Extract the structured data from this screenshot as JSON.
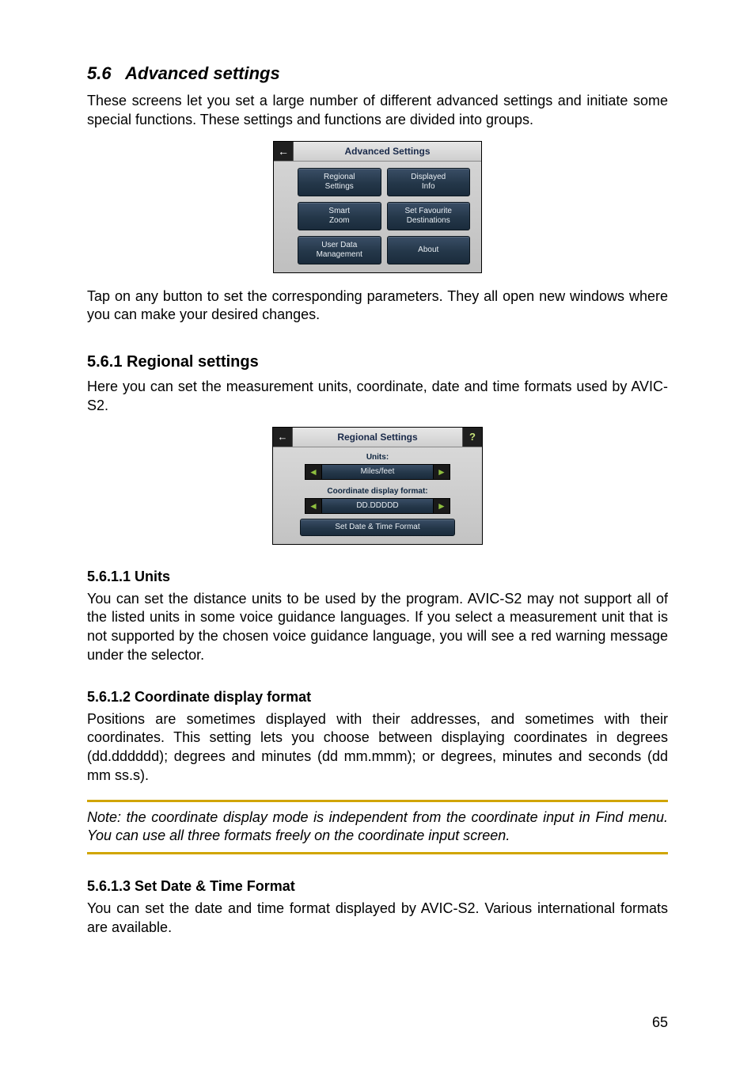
{
  "section": {
    "number": "5.6",
    "title": "Advanced settings",
    "intro": "These screens let you set a large number of different advanced settings and initiate some special functions. These settings and functions are divided into groups.",
    "after_shot": "Tap on any button to set the corresponding parameters. They all open new windows where you can make your desired changes."
  },
  "adv_shot": {
    "title": "Advanced Settings",
    "back_glyph": "←",
    "buttons": [
      "Regional\nSettings",
      "Displayed\nInfo",
      "Smart\nZoom",
      "Set Favourite\nDestinations",
      "User Data\nManagement",
      "About"
    ]
  },
  "sub561": {
    "heading": "5.6.1  Regional settings",
    "intro": "Here you can set the measurement units, coordinate, date and time formats used by AVIC-S2."
  },
  "reg_shot": {
    "title": "Regional Settings",
    "back_glyph": "←",
    "help_glyph": "?",
    "units_label": "Units:",
    "units_value": "Miles/feet",
    "coord_label": "Coordinate display format:",
    "coord_value": "DD.DDDDD",
    "set_dt_label": "Set Date & Time Format",
    "left_glyph": "◄",
    "right_glyph": "►"
  },
  "s5611": {
    "heading": "5.6.1.1  Units",
    "body": "You can set the distance units to be used by the program. AVIC-S2 may not support all of the listed units in some voice guidance languages. If you select a measurement unit that is not supported by the chosen voice guidance language, you will see a red warning message under the selector."
  },
  "s5612": {
    "heading": "5.6.1.2  Coordinate display format",
    "body": "Positions are sometimes displayed with their addresses, and sometimes with their coordinates. This setting lets you choose between displaying coordinates in degrees (dd.dddddd); degrees and minutes (dd mm.mmm); or degrees, minutes and seconds (dd mm ss.s).",
    "note": "Note: the coordinate display mode is independent from the coordinate input in Find menu. You can use all three formats freely on the coordinate input screen."
  },
  "s5613": {
    "heading": "5.6.1.3  Set Date & Time Format",
    "body": "You can set the date and time format displayed by AVIC-S2. Various international formats are available."
  },
  "page_number": "65"
}
